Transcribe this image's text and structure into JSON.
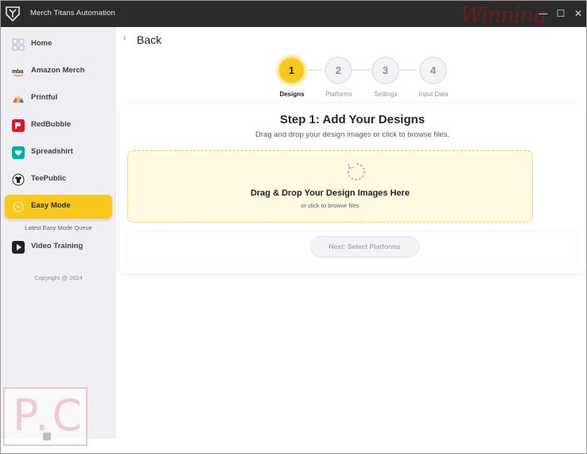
{
  "window": {
    "title": "Merch Titans Automation",
    "watermark_script": "Winning",
    "controls": {
      "minimize": "—",
      "maximize": "☐",
      "close": "✕"
    }
  },
  "sidebar": {
    "items": [
      {
        "label": "Home",
        "icon": "home-grid-icon",
        "active": false
      },
      {
        "label": "Amazon Merch",
        "icon": "amazon-icon",
        "active": false
      },
      {
        "label": "Printful",
        "icon": "printful-icon",
        "active": false
      },
      {
        "label": "RedBubble",
        "icon": "redbubble-icon",
        "active": false
      },
      {
        "label": "Spreadshirt",
        "icon": "spreadshirt-icon",
        "active": false
      },
      {
        "label": "TeePublic",
        "icon": "teepublic-icon",
        "active": false
      },
      {
        "label": "Easy Mode",
        "icon": "easy-mode-icon",
        "active": true
      },
      {
        "label": "Video Training",
        "icon": "play-icon",
        "active": false
      }
    ],
    "sub_link": "Latest Easy Mode Queue",
    "copyright": "Copyright @ 2024",
    "corner_watermark": "P.C"
  },
  "main": {
    "back": "Back",
    "steps": [
      {
        "number": "1",
        "label": "Designs",
        "active": true
      },
      {
        "number": "2",
        "label": "Platforms",
        "active": false
      },
      {
        "number": "3",
        "label": "Settings",
        "active": false
      },
      {
        "number": "4",
        "label": "Input Data",
        "active": false
      }
    ],
    "card": {
      "title": "Step 1: Add Your Designs",
      "subtitle": "Drag and drop your design images or click to browse files.",
      "dropzone_title": "Drag & Drop Your Design Images Here",
      "dropzone_sub": "or click to browse files",
      "next_button": "Next: Select Platforms"
    }
  },
  "colors": {
    "accent": "#f9c81d",
    "titlebar": "#2b2b2b",
    "sidebar_bg": "#efeff3",
    "dropzone_bg": "#fffbe0",
    "dropzone_border": "#f4cd2a"
  }
}
